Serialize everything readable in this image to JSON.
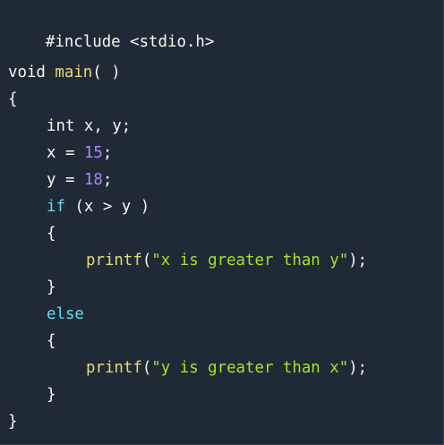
{
  "code": {
    "include": "#include <stdio.h>",
    "void_kw": "void",
    "main_fn": "main",
    "main_parens": "( )",
    "open_brace_main": "{",
    "int_kw": "int",
    "int_vars": "x, y;",
    "x_lhs": "x = ",
    "x_val": "15",
    "y_lhs": "y = ",
    "y_val": "18",
    "semi": ";",
    "if_kw": "if",
    "if_cond": "(x > y )",
    "open_brace_if": "{",
    "printf1_fn": "printf",
    "open_paren": "(",
    "str1": "\"x is greater than y\"",
    "close_stmt": ");",
    "close_brace_if": "}",
    "else_kw": "else",
    "open_brace_else": "{",
    "printf2_fn": "printf",
    "str2": "\"y is greater than x\"",
    "close_brace_else": "}",
    "close_brace_main": "}"
  },
  "colors": {
    "background": "#202a37",
    "keyword_cyan": "#66d9ef",
    "function_yellow": "#e6db74",
    "number_purple": "#ae81ff",
    "string_green": "#a6e22e",
    "text": "#f8f8f2"
  }
}
